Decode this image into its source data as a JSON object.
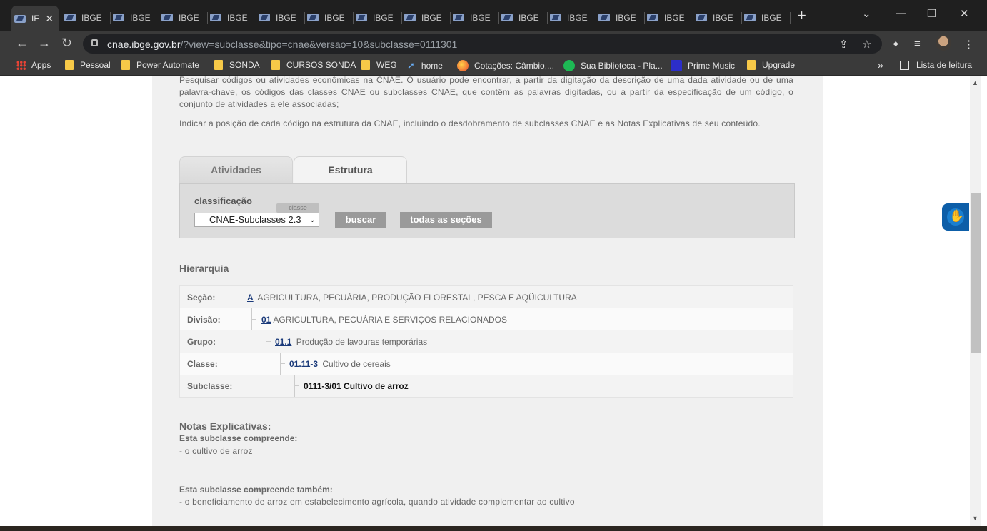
{
  "browser": {
    "tabs": [
      {
        "label": "IE",
        "active": true
      },
      {
        "label": "IBGE"
      },
      {
        "label": "IBGE"
      },
      {
        "label": "IBGE"
      },
      {
        "label": "IBGE"
      },
      {
        "label": "IBGE"
      },
      {
        "label": "IBGE"
      },
      {
        "label": "IBGE"
      },
      {
        "label": "IBGE"
      },
      {
        "label": "IBGE"
      },
      {
        "label": "IBGE"
      },
      {
        "label": "IBGE"
      },
      {
        "label": "IBGE"
      },
      {
        "label": "IBGE"
      },
      {
        "label": "IBGE"
      },
      {
        "label": "IBGE"
      }
    ],
    "url_host": "cnae.ibge.gov.br",
    "url_path": "/?view=subclasse&tipo=cnae&versao=10&subclasse=0111301",
    "bookmarks": [
      {
        "label": "Apps",
        "icon": "apps-grid-icon"
      },
      {
        "label": "Pessoal",
        "icon": "folder-icon"
      },
      {
        "label": "Power Automate",
        "icon": "folder-icon"
      },
      {
        "label": "SONDA",
        "icon": "folder-icon"
      },
      {
        "label": "CURSOS SONDA",
        "icon": "folder-icon"
      },
      {
        "label": "WEG",
        "icon": "folder-icon"
      },
      {
        "label": "home",
        "icon": "home-arrow-icon"
      },
      {
        "label": "Cotações: Câmbio,...",
        "icon": "cotacoes-icon"
      },
      {
        "label": "Sua Biblioteca - Pla...",
        "icon": "spotify-icon"
      },
      {
        "label": "Prime Music",
        "icon": "prime-music-icon"
      },
      {
        "label": "Upgrade",
        "icon": "folder-icon"
      }
    ],
    "reading_list": "Lista de leitura",
    "more": "»"
  },
  "page": {
    "intro_line1": "Pesquisar códigos ou atividades econômicas na CNAE. O usuário pode encontrar, a partir da digitação da descrição de uma dada atividade ou de uma palavra-chave, os códigos das classes CNAE ou subclasses CNAE, que contêm as palavras digitadas, ou a partir da especificação de um código, o conjunto de atividades a ele associadas;",
    "intro_line2": "Indicar a posição de cada código na estrutura da CNAE, incluindo o desdobramento de subclasses CNAE e as Notas Explicativas de seu conteúdo.",
    "tabs": {
      "atividades": "Atividades",
      "estrutura": "Estrutura"
    },
    "search": {
      "label": "classificação",
      "tip": "classe",
      "selected": "CNAE-Subclasses 2.3",
      "buscar": "buscar",
      "todas": "todas as seções"
    },
    "hierarchy_title": "Hierarquia",
    "hierarchy": [
      {
        "key": "Seção:",
        "code": "A",
        "text": "AGRICULTURA, PECUÁRIA, PRODUÇÃO FLORESTAL, PESCA E AQÜICULTURA"
      },
      {
        "key": "Divisão:",
        "code": "01",
        "text": "AGRICULTURA, PECUÁRIA E SERVIÇOS RELACIONADOS"
      },
      {
        "key": "Grupo:",
        "code": "01.1",
        "text": "Produção de lavouras temporárias"
      },
      {
        "key": "Classe:",
        "code": "01.11-3",
        "text": "Cultivo de cereais"
      },
      {
        "key": "Subclasse:",
        "text": "0111-3/01 Cultivo de arroz"
      }
    ],
    "notes_title": "Notas Explicativas:",
    "compreende_title": "Esta subclasse compreende:",
    "compreende_item": "- o cultivo de arroz",
    "tambem_title": "Esta subclasse compreende também:",
    "tambem_item": "- o beneficiamento de arroz em estabelecimento agrícola, quando atividade complementar ao cultivo"
  }
}
